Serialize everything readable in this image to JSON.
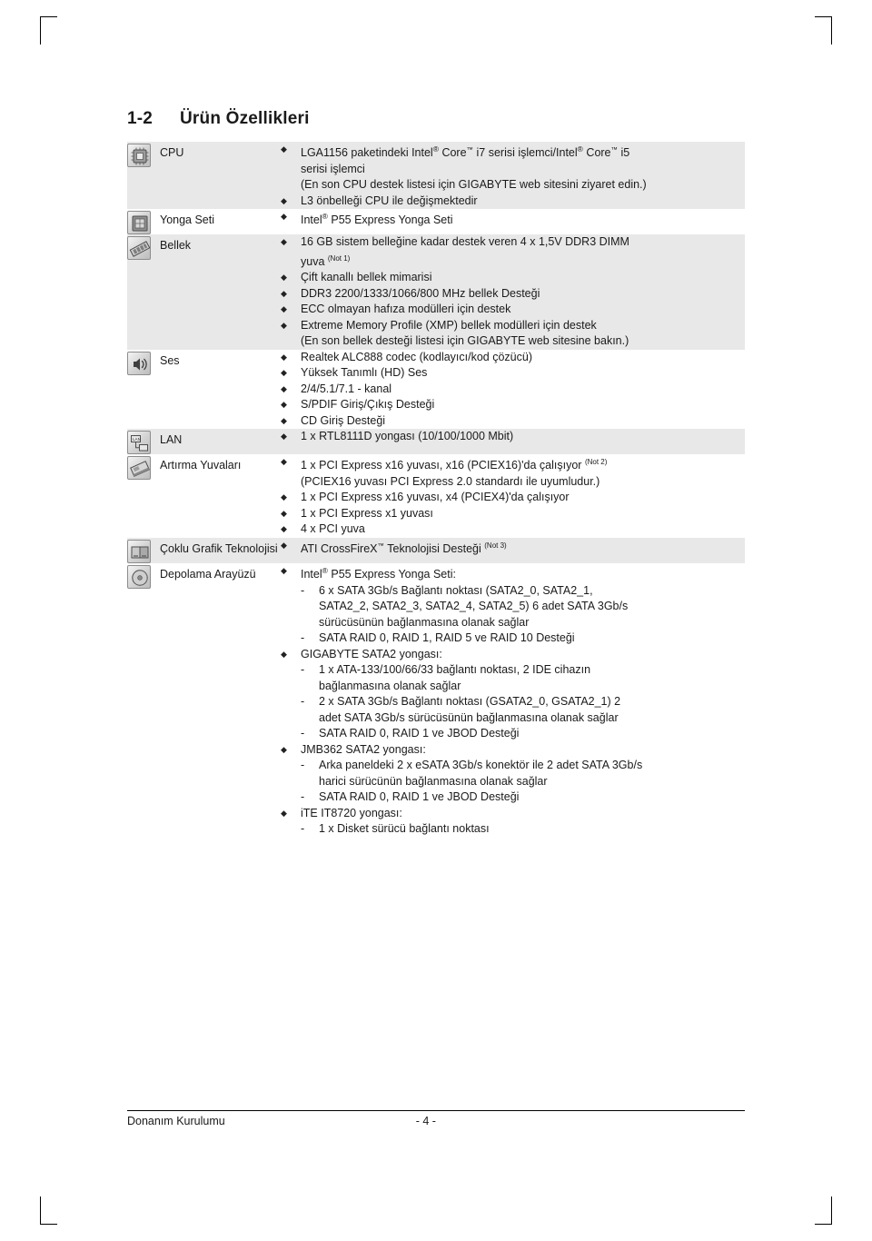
{
  "page": {
    "section_number": "1-2",
    "section_title": "Ürün Özellikleri",
    "footer_left": "Donanım Kurulumu",
    "footer_center": "- 4 -"
  },
  "bullet_glyph": "◆",
  "dash_glyph": "-",
  "rows": [
    {
      "icon": "cpu-icon",
      "label": "CPU",
      "shade": "gray",
      "entries": [
        {
          "lines": [
            "LGA1156 paketindeki Intel® Core™ i7 serisi işlemci/Intel® Core™ i5",
            "serisi işlemci",
            "(En son CPU destek listesi için GIGABYTE web sitesini ziyaret edin.)"
          ]
        },
        {
          "lines": [
            "L3 önbelleği CPU ile değişmektedir"
          ]
        }
      ]
    },
    {
      "icon": "chipset-icon",
      "label": "Yonga Seti",
      "shade": "white",
      "entries": [
        {
          "lines": [
            "Intel® P55 Express Yonga Seti"
          ]
        }
      ]
    },
    {
      "icon": "memory-icon",
      "label": "Bellek",
      "shade": "gray",
      "entries": [
        {
          "lines": [
            "16 GB sistem belleğine kadar destek veren 4 x 1,5V DDR3 DIMM",
            "yuva (Not 1)"
          ]
        },
        {
          "lines": [
            "Çift kanallı bellek mimarisi"
          ]
        },
        {
          "lines": [
            "DDR3 2200/1333/1066/800 MHz bellek Desteği"
          ]
        },
        {
          "lines": [
            "ECC olmayan hafıza modülleri için destek"
          ]
        },
        {
          "lines": [
            "Extreme Memory Profile (XMP) bellek modülleri için destek",
            "(En son bellek desteği listesi için GIGABYTE web sitesine bakın.)"
          ]
        }
      ]
    },
    {
      "icon": "audio-icon",
      "label": "Ses",
      "shade": "white",
      "entries": [
        {
          "lines": [
            "Realtek ALC888 codec (kodlayıcı/kod çözücü)"
          ]
        },
        {
          "lines": [
            "Yüksek Tanımlı (HD) Ses"
          ]
        },
        {
          "lines": [
            "2/4/5.1/7.1 - kanal"
          ]
        },
        {
          "lines": [
            "S/PDIF Giriş/Çıkış Desteği"
          ]
        },
        {
          "lines": [
            "CD Giriş Desteği"
          ]
        }
      ]
    },
    {
      "icon": "lan-icon",
      "label": "LAN",
      "shade": "gray",
      "entries": [
        {
          "lines": [
            "1 x RTL8111D yongası (10/100/1000 Mbit)"
          ]
        }
      ]
    },
    {
      "icon": "expansion-icon",
      "label": "Artırma Yuvaları",
      "shade": "white",
      "entries": [
        {
          "lines": [
            "1 x PCI Express x16 yuvası, x16 (PCIEX16)'da çalışıyor (Not 2)",
            "(PCIEX16 yuvası PCI Express 2.0 standardı ile uyumludur.)"
          ]
        },
        {
          "lines": [
            "1 x PCI Express x16 yuvası, x4 (PCIEX4)'da çalışıyor"
          ]
        },
        {
          "lines": [
            "1 x PCI Express x1 yuvası"
          ]
        },
        {
          "lines": [
            "4 x PCI yuva"
          ]
        }
      ]
    },
    {
      "icon": "multigraphics-icon",
      "label": "Çoklu Grafik Teknolojisi",
      "shade": "gray",
      "entries": [
        {
          "lines": [
            "ATI CrossFireX™ Teknolojisi Desteği (Not 3)"
          ]
        }
      ]
    },
    {
      "icon": "storage-icon",
      "label": "Depolama Arayüzü",
      "shade": "white",
      "entries": [
        {
          "lines": [
            "Intel® P55 Express Yonga Seti:"
          ],
          "subs": [
            "6 x SATA 3Gb/s Bağlantı noktası (SATA2_0, SATA2_1,",
            "SATA2_2, SATA2_3, SATA2_4, SATA2_5) 6 adet SATA 3Gb/s",
            "sürücüsünün bağlanmasına olanak sağlar",
            "SATA RAID 0, RAID 1, RAID 5 ve RAID 10 Desteği"
          ],
          "sub_has_dash": [
            true,
            false,
            false,
            true
          ]
        },
        {
          "lines": [
            "GIGABYTE SATA2 yongası:"
          ],
          "subs": [
            "1 x ATA-133/100/66/33 bağlantı noktası, 2 IDE cihazın",
            "bağlanmasına olanak sağlar",
            "2 x SATA 3Gb/s Bağlantı noktası (GSATA2_0, GSATA2_1) 2",
            "adet SATA 3Gb/s sürücüsünün bağlanmasına olanak sağlar",
            "SATA RAID 0, RAID 1 ve JBOD Desteği"
          ],
          "sub_has_dash": [
            true,
            false,
            true,
            false,
            true
          ]
        },
        {
          "lines": [
            "JMB362 SATA2 yongası:"
          ],
          "subs": [
            "Arka paneldeki 2 x eSATA 3Gb/s konektör ile 2 adet SATA 3Gb/s",
            "harici sürücünün bağlanmasına olanak sağlar",
            "SATA RAID 0, RAID 1 ve JBOD Desteği"
          ],
          "sub_has_dash": [
            true,
            false,
            true
          ]
        },
        {
          "lines": [
            "iTE IT8720 yongası:"
          ],
          "subs": [
            "1 x Disket sürücü bağlantı noktası"
          ],
          "sub_has_dash": [
            true
          ]
        }
      ]
    }
  ]
}
